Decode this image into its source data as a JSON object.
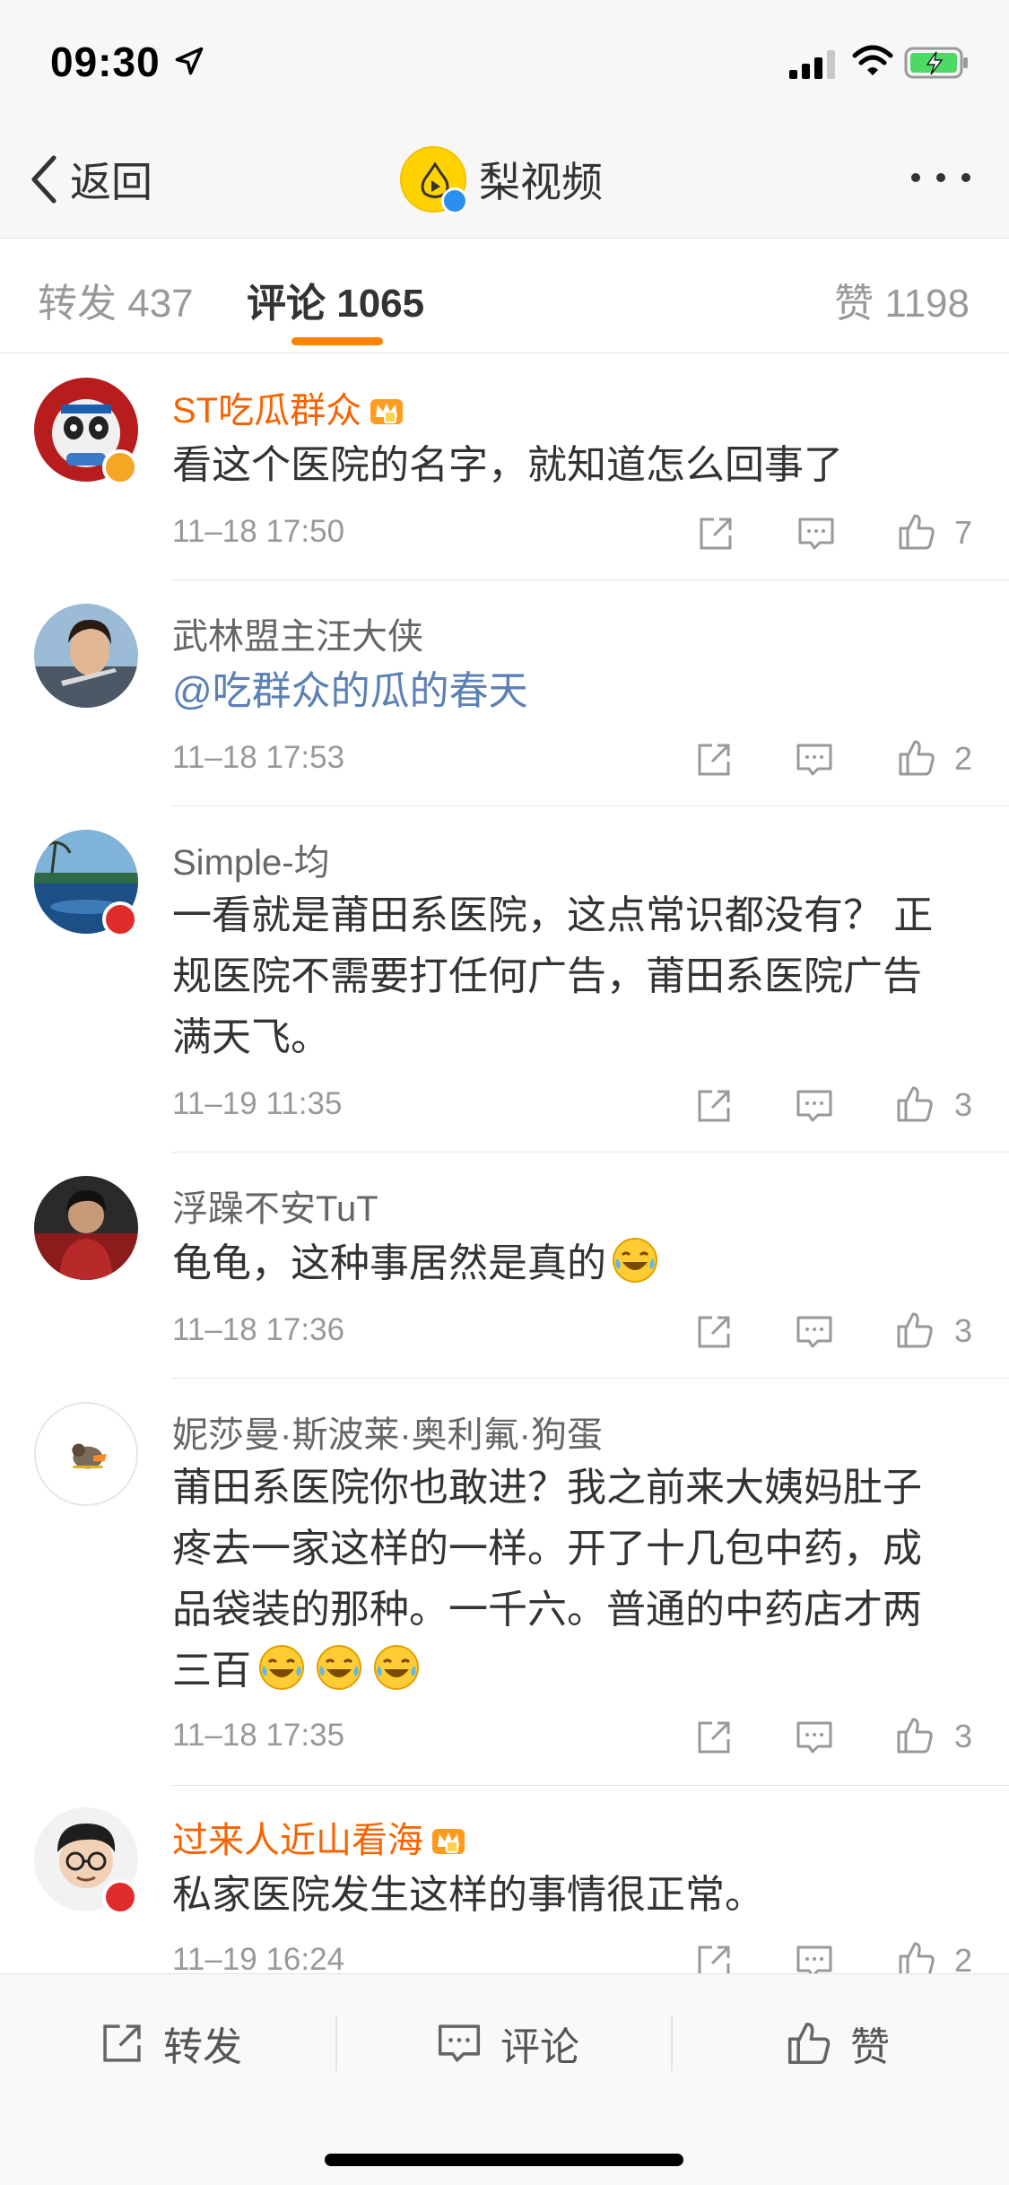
{
  "status_bar": {
    "time": "09:30"
  },
  "nav": {
    "back_label": "返回",
    "title": "梨视频"
  },
  "tabs": [
    {
      "label": "转发 437"
    },
    {
      "label": "评论 1065"
    },
    {
      "label": "赞 1198"
    }
  ],
  "comments": [
    {
      "name": "ST吃瓜群众",
      "text": "看这个医院的名字，就知道怎么回事了",
      "time": "11–18 17:50",
      "likes": "7"
    },
    {
      "name": "武林盟主汪大侠",
      "text": "@吃群众的瓜的春天",
      "time": "11–18 17:53",
      "likes": "2"
    },
    {
      "name": "Simple-均",
      "text_lines": [
        "一看就是莆田系医院，这点常识都没有？  正",
        "规医院不需要打任何广告，莆田系医院广告",
        "满天飞。"
      ],
      "time": "11–19 11:35",
      "likes": "3"
    },
    {
      "name": "浮躁不安TuT",
      "text": "龟龟，这种事居然是真的",
      "time": "11–18 17:36",
      "likes": "3"
    },
    {
      "name": "妮莎曼·斯波莱·奥利氟·狗蛋",
      "text_lines": [
        "莆田系医院你也敢进？我之前来大姨妈肚子",
        "疼去一家这样的一样。开了十几包中药，成",
        "品袋装的那种。一千六。普通的中药店才两",
        "三百"
      ],
      "time": "11–18 17:35",
      "likes": "3"
    },
    {
      "name": "过来人近山看海",
      "text": "私家医院发生这样的事情很正常。",
      "time": "11–19 16:24",
      "likes": "2"
    }
  ],
  "bottom_bar": {
    "repost": "转发",
    "comment": "评论",
    "like": "赞"
  },
  "colors": {
    "accent": "#ff8200",
    "vip_name": "#f86301",
    "mention": "#5b80b6"
  },
  "icons": [
    "back-chevron-icon",
    "more-icon",
    "repost-icon",
    "comment-icon",
    "like-icon",
    "crown-icon",
    "laughing-tears-emoji"
  ]
}
